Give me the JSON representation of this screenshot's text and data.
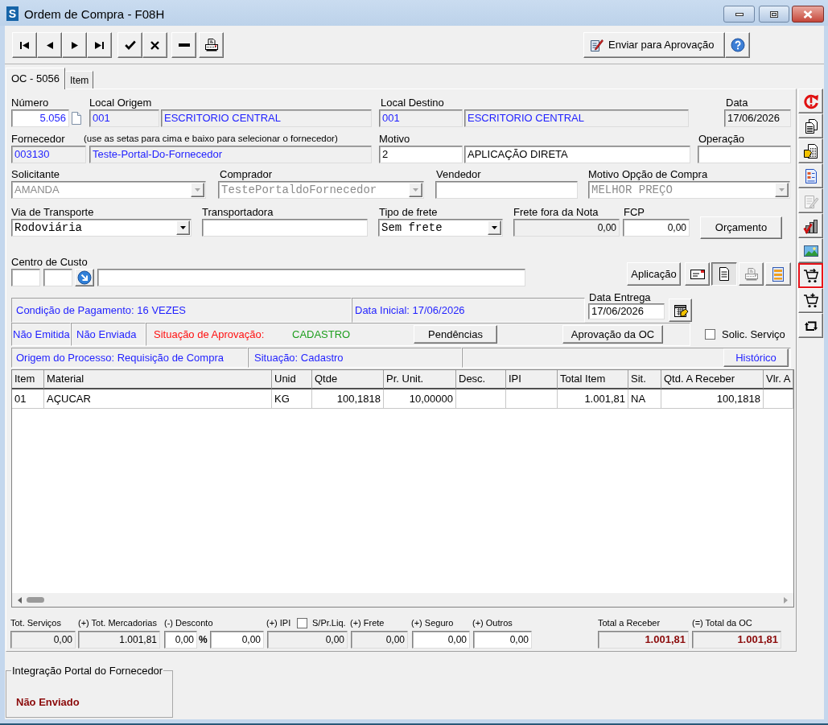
{
  "window": {
    "app_icon": "S",
    "title": "Ordem de Compra - F08H"
  },
  "toolbar": {
    "buttons": [
      {
        "kind": "first"
      },
      {
        "kind": "previous"
      },
      {
        "kind": "next"
      },
      {
        "kind": "last"
      },
      {
        "kind": "confirm"
      },
      {
        "kind": "cancel"
      },
      {
        "kind": "delete"
      },
      {
        "kind": "print"
      }
    ],
    "send_button": "Enviar para Aprovação"
  },
  "tabs": [
    {
      "label": "OC - 5056",
      "selected": true
    },
    {
      "label": "Item",
      "selected": false
    }
  ],
  "header": {
    "numero": {
      "label": "Número",
      "value": "5.056",
      "readonly": false
    },
    "local_origem": {
      "label": "Local Origem",
      "code": "001",
      "name": "ESCRITORIO CENTRAL",
      "readonly": true
    },
    "local_destino": {
      "label": "Local Destino",
      "code": "001",
      "name": "ESCRITORIO CENTRAL",
      "readonly": true
    },
    "data": {
      "label": "Data",
      "value": "17/06/2026",
      "readonly": true
    },
    "fornecedor": {
      "label": "Fornecedor",
      "hint": "(use as setas para cima e baixo para selecionar o fornecedor)",
      "code": "003130",
      "name": "Teste-Portal-Do-Fornecedor",
      "readonly": true
    },
    "motivo": {
      "label": "Motivo",
      "code": "2",
      "name": "APLICAÇÃO DIRETA",
      "readonly": false
    },
    "operacao": {
      "label": "Operação",
      "readonly": false
    },
    "solicitante": {
      "label": "Solicitante",
      "value": "AMANDA",
      "disabled": true
    },
    "comprador": {
      "label": "Comprador",
      "value": "TestePortaldoFornecedor",
      "disabled": true
    },
    "vendedor": {
      "label": "Vendedor",
      "readonly": false
    },
    "motivo_opcao_compra": {
      "label": "Motivo Opção de Compra",
      "value": "MELHOR PREÇO",
      "disabled": true
    },
    "via_transporte": {
      "label": "Via de Transporte",
      "value": "Rodoviária",
      "disabled": false
    },
    "transportadora": {
      "label": "Transportadora",
      "readonly": false
    },
    "tipo_frete": {
      "label": "Tipo de frete",
      "value": "Sem frete",
      "disabled": false
    },
    "frete_fora_nota": {
      "label": "Frete fora da Nota",
      "value": "0,00",
      "readonly": true
    },
    "fcp": {
      "label": "FCP",
      "value": "0,00",
      "readonly": false
    },
    "orcamento_button": "Orçamento",
    "centro_custo": {
      "label": "Centro de Custo"
    }
  },
  "actions": [
    {
      "kind": "text",
      "label": "Aplicação",
      "pressed": false,
      "disabled": false
    },
    {
      "kind": "card",
      "pressed": false,
      "disabled": false
    },
    {
      "kind": "document",
      "pressed": true,
      "disabled": false
    },
    {
      "kind": "print",
      "pressed": false,
      "disabled": true
    },
    {
      "kind": "list",
      "pressed": false,
      "disabled": false
    }
  ],
  "payment": {
    "condition": "Condição de Pagamento: 16 VEZES",
    "start_date": "Data Inicial: 17/06/2026"
  },
  "delivery_date": {
    "label": "Data Entrega",
    "value": "17/06/2026"
  },
  "status": {
    "emission": "Não Emitida",
    "sending": "Não Enviada",
    "approval_label": "Situação de Aprovação:",
    "approval_value": "CADASTRO",
    "pending_button": "Pendências",
    "approval_button": "Aprovação da OC"
  },
  "service_request": {
    "label": "Solic. Serviço",
    "checked": false
  },
  "origin": {
    "process": "Origem do Processo: Requisição de Compra",
    "situation": "Situação: Cadastro",
    "history_button": "Histórico"
  },
  "table": {
    "columns": [
      "Item",
      "Material",
      "Unid",
      "Qtde",
      "Pr. Unit.",
      "Desc.",
      "IPI",
      "Total Item",
      "Sit.",
      "Qtd. A Receber",
      "Vlr. A"
    ],
    "rows": [
      {
        "cells": [
          "01",
          "AÇUCAR",
          "KG",
          "100,1818",
          "10,00000",
          null,
          null,
          "1.001,81",
          "NA",
          "100,1818",
          null
        ]
      }
    ]
  },
  "totals": {
    "services": {
      "label": "Tot. Serviços",
      "value": "0,00",
      "readonly": true
    },
    "goods": {
      "label": "(+) Tot. Mercadorias",
      "value": "1.001,81",
      "readonly": true
    },
    "discount": {
      "label": "(-) Desconto",
      "percent": "0,00",
      "percent_sign": "%",
      "value": "0,00",
      "readonly": false
    },
    "ipi": {
      "label": "(+) IPI",
      "value": "0,00",
      "readonly": true
    },
    "net_price": {
      "label": "S/Pr.Liq.",
      "checked": false
    },
    "freight": {
      "label": "(+) Frete",
      "value": "0,00",
      "readonly": true
    },
    "insurance": {
      "label": "(+) Seguro",
      "value": "0,00",
      "readonly": false
    },
    "other": {
      "label": "(+) Outros",
      "value": "0,00",
      "readonly": false
    },
    "total_receivable": {
      "label": "Total a Receber",
      "value": "1.001,81",
      "readonly": true
    },
    "order_total": {
      "label": "(=) Total da OC",
      "value": "1.001,81",
      "readonly": true
    }
  },
  "side_toolbar": [
    {
      "kind": "alert",
      "disabled": false,
      "highlighted": false
    },
    {
      "kind": "copy",
      "disabled": false,
      "highlighted": false
    },
    {
      "kind": "document_edit",
      "disabled": false,
      "highlighted": false
    },
    {
      "kind": "form",
      "disabled": false,
      "highlighted": false
    },
    {
      "kind": "note",
      "disabled": true,
      "highlighted": false
    },
    {
      "kind": "chart",
      "disabled": false,
      "highlighted": false
    },
    {
      "kind": "image",
      "disabled": false,
      "highlighted": false
    },
    {
      "kind": "cart_arrow",
      "disabled": false,
      "highlighted": true
    },
    {
      "kind": "cart_plus",
      "disabled": false,
      "highlighted": false
    },
    {
      "kind": "loop",
      "disabled": false,
      "highlighted": false
    }
  ],
  "integration": {
    "title": "Integração Portal do Fornecedor",
    "status": "Não Enviado"
  }
}
